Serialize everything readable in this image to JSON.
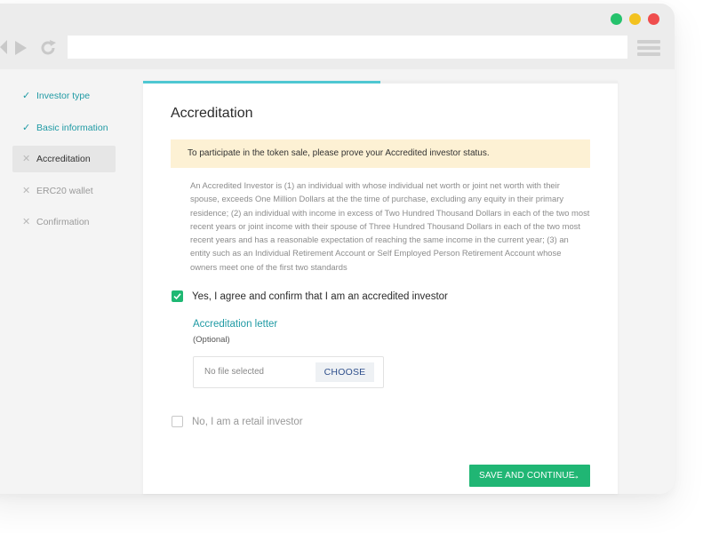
{
  "browser": {
    "icons": [
      "back-icon",
      "forward-icon",
      "reload-icon",
      "menu-icon"
    ],
    "url": ""
  },
  "sidebar": {
    "items": [
      {
        "label": "Investor type",
        "status": "done"
      },
      {
        "label": "Basic information",
        "status": "done"
      },
      {
        "label": "Accreditation",
        "status": "active"
      },
      {
        "label": "ERC20 wallet",
        "status": "pending"
      },
      {
        "label": "Confirmation",
        "status": "pending"
      }
    ]
  },
  "main": {
    "progress": 0.5,
    "title": "Accreditation",
    "notice": "To participate in the token sale, please prove your Accredited investor status.",
    "description": "An Accredited Investor is (1) an individual with whose individual net worth or joint net worth with their spouse, exceeds One Million Dollars at the the time of purchase, excluding any equity in their primary residence; (2) an individual with income in excess of Two Hundred Thousand Dollars in each of the two most recent years or joint income with their spouse of Three Hundred Thousand Dollars in each of the two most recent years and has a reasonable expectation of reaching the same income in the current year; (3) an entity such as an Individual Retirement Account or Self Employed Person Retirement Account whose owners meet one of the first two standards",
    "option_yes": {
      "label": "Yes, I agree and confirm that I am an accredited investor",
      "checked": true
    },
    "upload": {
      "title": "Accreditation letter",
      "optional": "(Optional)",
      "file_status": "No file selected",
      "choose_label": "CHOOSE"
    },
    "option_no": {
      "label": "No, I am a retail investor",
      "checked": false
    },
    "submit_label": "SAVE AND CONTINUE",
    "submit_arrow": "→"
  },
  "colors": {
    "accent_teal": "#1f9aa4",
    "progress": "#4ec7d2",
    "primary_green": "#20b674",
    "notice_bg": "#fdf1d4"
  }
}
